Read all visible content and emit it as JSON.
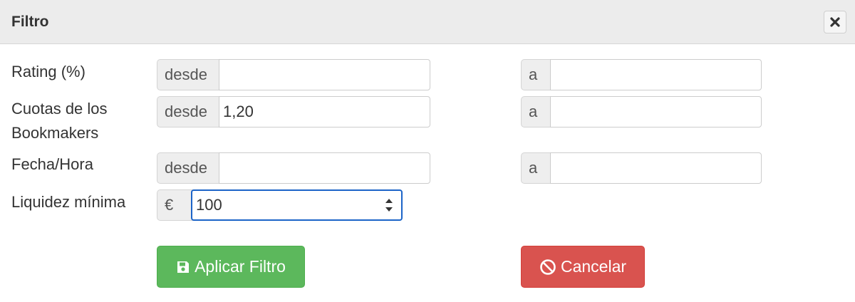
{
  "dialog": {
    "title": "Filtro"
  },
  "rows": {
    "rating": {
      "label": "Rating (%)",
      "from_addon": "desde",
      "from_value": "",
      "to_addon": "a",
      "to_value": ""
    },
    "odds": {
      "label": "Cuotas de los Bookmakers",
      "from_addon": "desde",
      "from_value": "1,20",
      "to_addon": "a",
      "to_value": ""
    },
    "date": {
      "label": "Fecha/Hora",
      "from_addon": "desde",
      "from_value": "",
      "to_addon": "a",
      "to_value": ""
    },
    "liquidity": {
      "label": "Liquidez mínima",
      "addon": "€",
      "value": "100"
    }
  },
  "buttons": {
    "apply": "Aplicar Filtro",
    "cancel": "Cancelar"
  },
  "icons": {
    "close": "close-icon",
    "apply": "floppy-disk-icon",
    "cancel": "ban-icon"
  },
  "colors": {
    "apply_bg": "#5cb85c",
    "cancel_bg": "#d9534f",
    "focus_border": "#1c64c8"
  }
}
